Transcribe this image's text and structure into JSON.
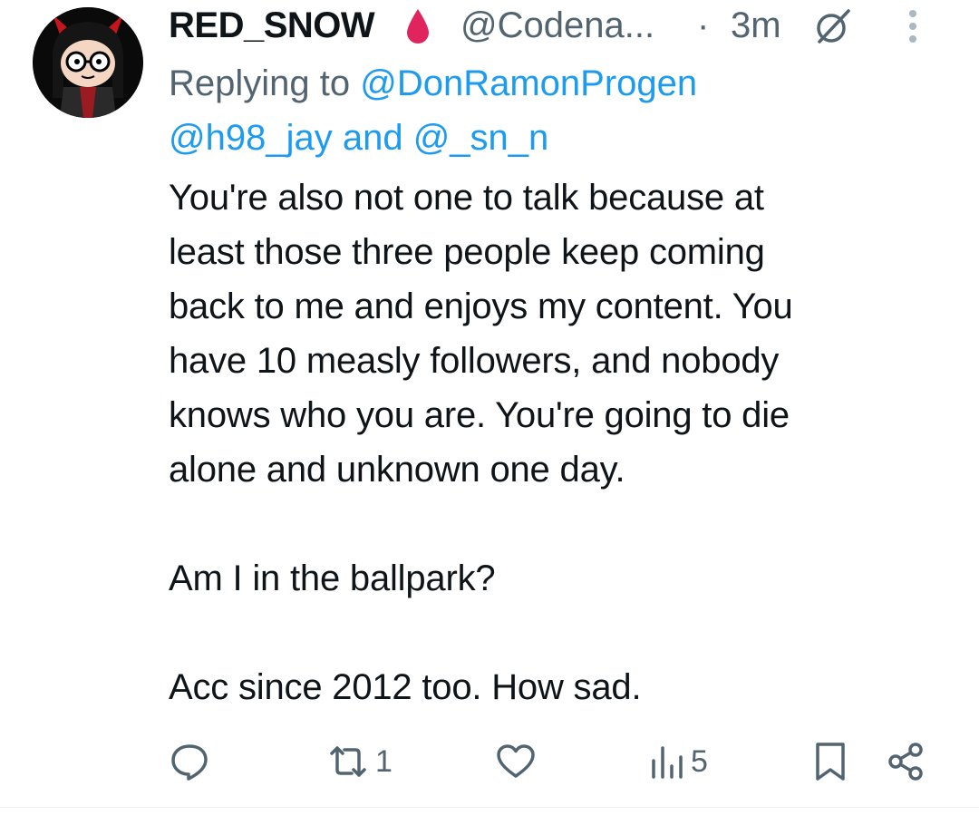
{
  "tweet": {
    "display_name": "RED_SNOW",
    "handle": "@Codena...",
    "separator": "·",
    "time": "3m",
    "replying_prefix": "Replying to ",
    "reply_mention_1": "@DonRamonProgen",
    "reply_mention_2": "@h98_jay",
    "reply_and": " and ",
    "reply_mention_3": "@_sn_n",
    "body": "You're also not one to talk because at\nleast those three people keep coming\nback to me and enjoys my content. You\nhave 10 measly followers, and nobody\nknows who you are. You're going to die\nalone and unknown one day.\n\nAm I in the ballpark?\n\nAcc since 2012 too. How sad.",
    "icons": {
      "name_badge": "blood-drop-icon",
      "grok": "grok-icon",
      "more": "more-vertical-icon"
    }
  },
  "actions": {
    "reply_icon": "reply-icon",
    "retweet_icon": "retweet-icon",
    "retweet_count": "1",
    "like_icon": "heart-icon",
    "views_icon": "views-icon",
    "views_count": "5",
    "bookmark_icon": "bookmark-icon",
    "share_icon": "share-icon"
  },
  "colors": {
    "text": "#0f1419",
    "secondary": "#536471",
    "link": "#1d9bf0",
    "badge": "#e0245e"
  }
}
